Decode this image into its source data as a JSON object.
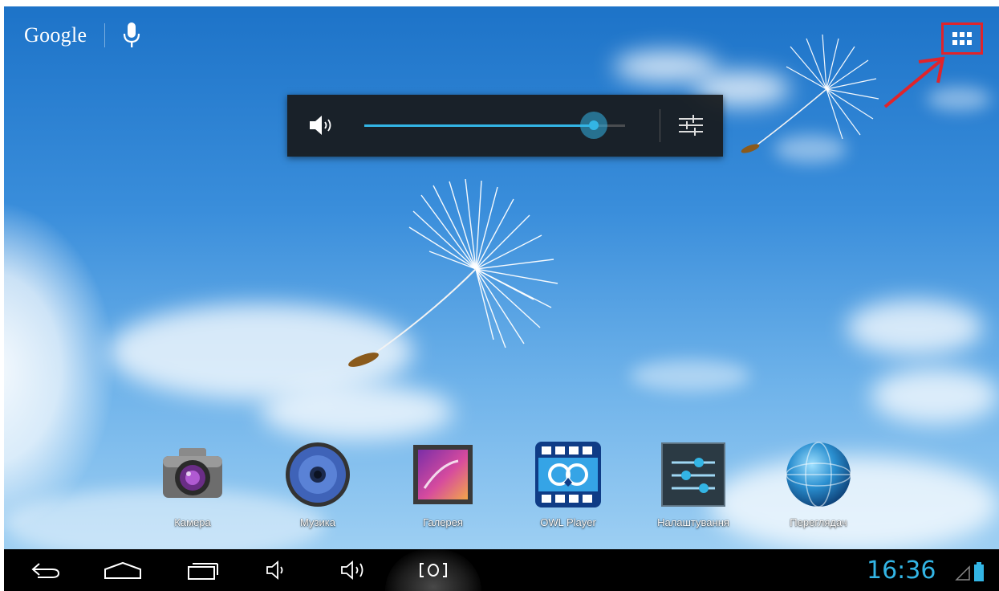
{
  "search": {
    "logo_text": "Google",
    "logo_icon": "google-logo",
    "mic_icon": "mic-icon"
  },
  "app_drawer": {
    "icon": "grid-apps-icon",
    "highlight_color": "#e0242b"
  },
  "volume_panel": {
    "level_percent": 88,
    "accent_color": "#33b5e5",
    "icons": {
      "speaker": "speaker-icon",
      "settings": "sliders-icon"
    }
  },
  "dock": {
    "apps": [
      {
        "label": "Камера",
        "icon": "camera-icon"
      },
      {
        "label": "Музика",
        "icon": "music-speaker-icon"
      },
      {
        "label": "Галерея",
        "icon": "gallery-icon"
      },
      {
        "label": "OWL Player",
        "icon": "owl-player-icon"
      },
      {
        "label": "Налаштування",
        "icon": "settings-sliders-icon"
      },
      {
        "label": "Переглядач",
        "icon": "globe-browser-icon"
      }
    ]
  },
  "navbar": {
    "buttons": [
      "back-icon",
      "home-icon",
      "recents-icon",
      "volume-down-icon",
      "volume-up-icon",
      "screenshot-icon"
    ],
    "clock": "16:36",
    "status_icons": [
      "signal-icon",
      "battery-icon"
    ]
  }
}
